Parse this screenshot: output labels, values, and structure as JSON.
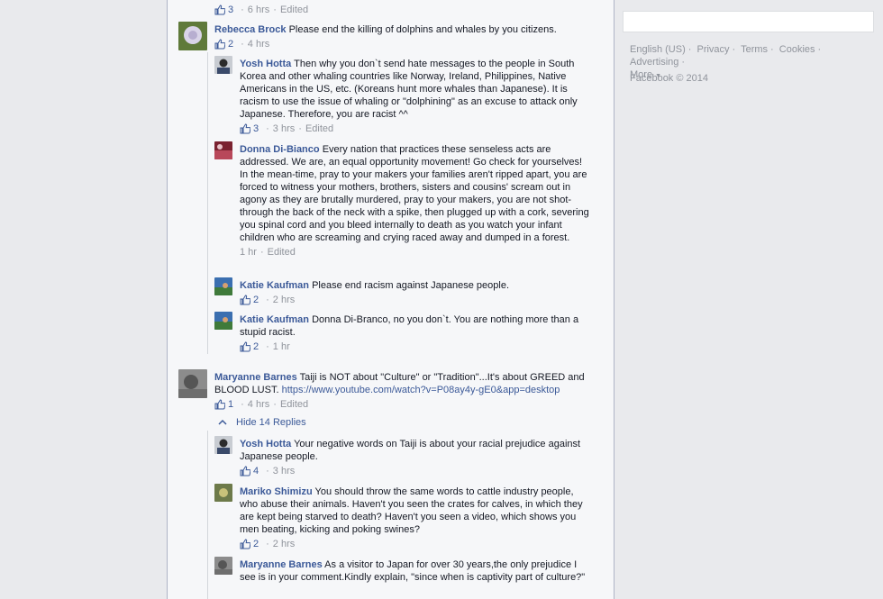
{
  "comments": [
    {
      "top_meta": {
        "likes": "3",
        "time": "6 hrs",
        "edited": "Edited"
      }
    },
    {
      "author": "Rebecca Brock",
      "text": "Please end the killing of dolphins and whales by you citizens.",
      "likes": "2",
      "time": "4 hrs",
      "replies": [
        {
          "author": "Yosh Hotta",
          "text": "Then why you don`t send hate messages to the people in South Korea and other whaling countries like Norway, Ireland, Philippines, Native Americans in the US, etc. (Koreans hunt more whales than Japanese). It is racism to use the issue of whaling or \"dolphining\" as an excuse to attack only Japanese. Therefore, you are racist ^^",
          "likes": "3",
          "time": "3 hrs",
          "edited": "Edited"
        },
        {
          "author": "Donna Di-Bianco",
          "text": "Every nation that practices these senseless acts are addressed. We are, an equal opportunity movement! Go check for yourselves! In the mean-time, pray to your makers your families aren't ripped apart, you are forced to witness your mothers, brothers, sisters and cousins' scream out in agony as they are brutally murdered, pray to your makers, you are not shot-through the back of the neck with a spike, then plugged up with a cork, severing you spinal cord and you bleed internally to death as you watch your infant children who are screaming and crying raced away and dumped in a forest.",
          "time": "1 hr",
          "edited": "Edited"
        },
        {
          "author": "Katie Kaufman",
          "text": "Please end racism against Japanese people.",
          "likes": "2",
          "time": "2 hrs"
        },
        {
          "author": "Katie Kaufman",
          "text": "Donna Di-Branco, no you don`t. You are nothing more than a stupid racist.",
          "likes": "2",
          "time": "1 hr"
        }
      ]
    },
    {
      "author": "Maryanne Barnes",
      "text": "Taiji is NOT about \"Culture\" or \"Tradition\"...It's about GREED and BLOOD LUST.",
      "link": "https://www.youtube.com/watch?v=P08ay4y-gE0&app=desktop",
      "likes": "1",
      "time": "4 hrs",
      "edited": "Edited",
      "hide_replies": "Hide 14 Replies",
      "replies": [
        {
          "author": "Yosh Hotta",
          "text": "Your negative words on Taiji is about your racial prejudice against Japanese people.",
          "likes": "4",
          "time": "3 hrs"
        },
        {
          "author": "Mariko Shimizu",
          "text": "You should throw the same words to cattle industry people, who abuse their animals. Haven't you seen the crates for calves, in which they are kept being starved to death? Haven't you seen a video, which shows you men beating, kicking and poking swines?",
          "likes": "2",
          "time": "2 hrs"
        },
        {
          "author": "Maryanne Barnes",
          "text": "As a visitor to Japan for over 30 years,the only prejudice I see is in your comment.Kindly explain, \"since when is captivity part of culture?\""
        }
      ]
    }
  ],
  "sidebar": {
    "links": [
      "English (US)",
      "Privacy",
      "Terms",
      "Cookies",
      "Advertising",
      "More"
    ],
    "copyright": "Facebook © 2014"
  },
  "colors": {
    "link": "#3b5998",
    "meta": "#90949c",
    "background": "#e9eaed"
  }
}
